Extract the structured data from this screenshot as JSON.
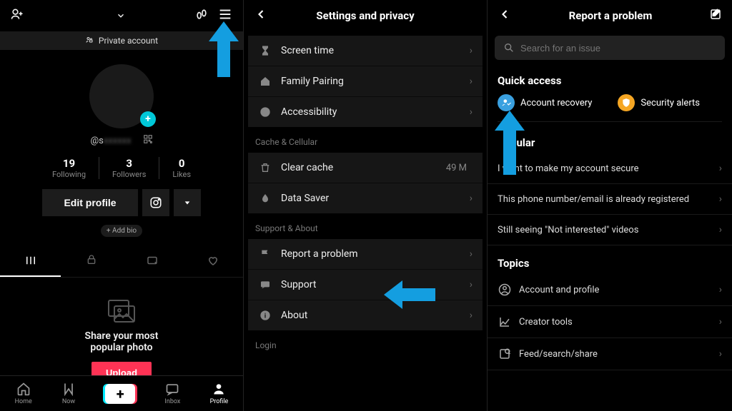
{
  "panel1": {
    "private_label": "Private account",
    "handle_prefix": "@s",
    "stats": [
      {
        "num": "19",
        "label": "Following"
      },
      {
        "num": "3",
        "label": "Followers"
      },
      {
        "num": "0",
        "label": "Likes"
      }
    ],
    "edit_btn": "Edit profile",
    "add_bio": "+ Add bio",
    "empty_line1": "Share your most",
    "empty_line2": "popular photo",
    "upload_btn": "Upload",
    "nav": [
      {
        "label": "Home"
      },
      {
        "label": "Now"
      },
      {
        "label": ""
      },
      {
        "label": "Inbox"
      },
      {
        "label": "Profile"
      }
    ]
  },
  "panel2": {
    "title": "Settings and privacy",
    "group1": [
      {
        "label": "Screen time"
      },
      {
        "label": "Family Pairing"
      },
      {
        "label": "Accessibility"
      }
    ],
    "section_cache": "Cache & Cellular",
    "group2": [
      {
        "label": "Clear cache",
        "value": "49 M"
      },
      {
        "label": "Data Saver"
      }
    ],
    "section_support": "Support & About",
    "group3": [
      {
        "label": "Report a problem"
      },
      {
        "label": "Support"
      },
      {
        "label": "About"
      }
    ],
    "section_login": "Login"
  },
  "panel3": {
    "title": "Report a problem",
    "search_placeholder": "Search for an issue",
    "quick_access": "Quick access",
    "qa_items": [
      {
        "label": "Account recovery"
      },
      {
        "label": "Security alerts"
      }
    ],
    "popular": "Popular",
    "popular_items": [
      "I want to make my account secure",
      "This phone number/email is already registered",
      "Still seeing \"Not interested\" videos"
    ],
    "topics": "Topics",
    "topic_items": [
      "Account and profile",
      "Creator tools",
      "Feed/search/share"
    ]
  }
}
